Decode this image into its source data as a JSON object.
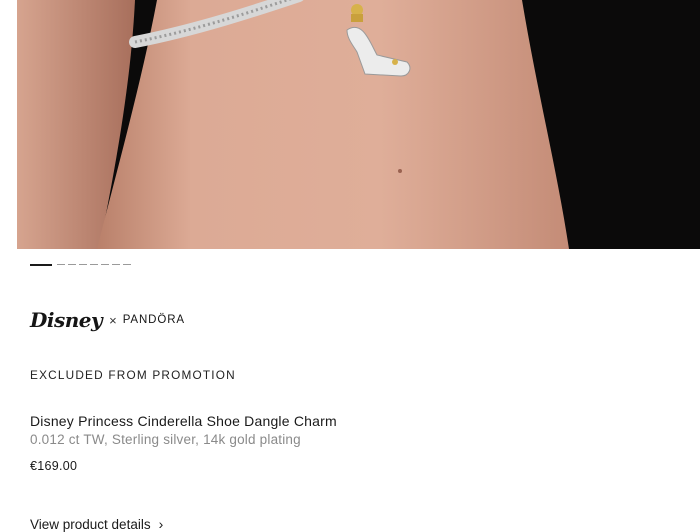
{
  "product_image": {
    "alt": "Disney Princess Cinderella Shoe Dangle Charm on arm"
  },
  "carousel": {
    "total": 8,
    "active_index": 0
  },
  "brand": {
    "disney": "Disney",
    "separator": "×",
    "pandora": "PANDÖRA"
  },
  "promo_badge": "EXCLUDED FROM PROMOTION",
  "product": {
    "name": "Disney Princess Cinderella Shoe Dangle Charm",
    "specs": "0.012 ct TW, Sterling silver, 14k gold plating",
    "price": "€169.00"
  },
  "links": {
    "view_details": "View product details",
    "chevron": "›"
  },
  "colors": {
    "hero_background": "#0b0a0a",
    "skin": "#d9a38c",
    "text": "#1a1a1a",
    "muted": "#8a8a8a"
  }
}
